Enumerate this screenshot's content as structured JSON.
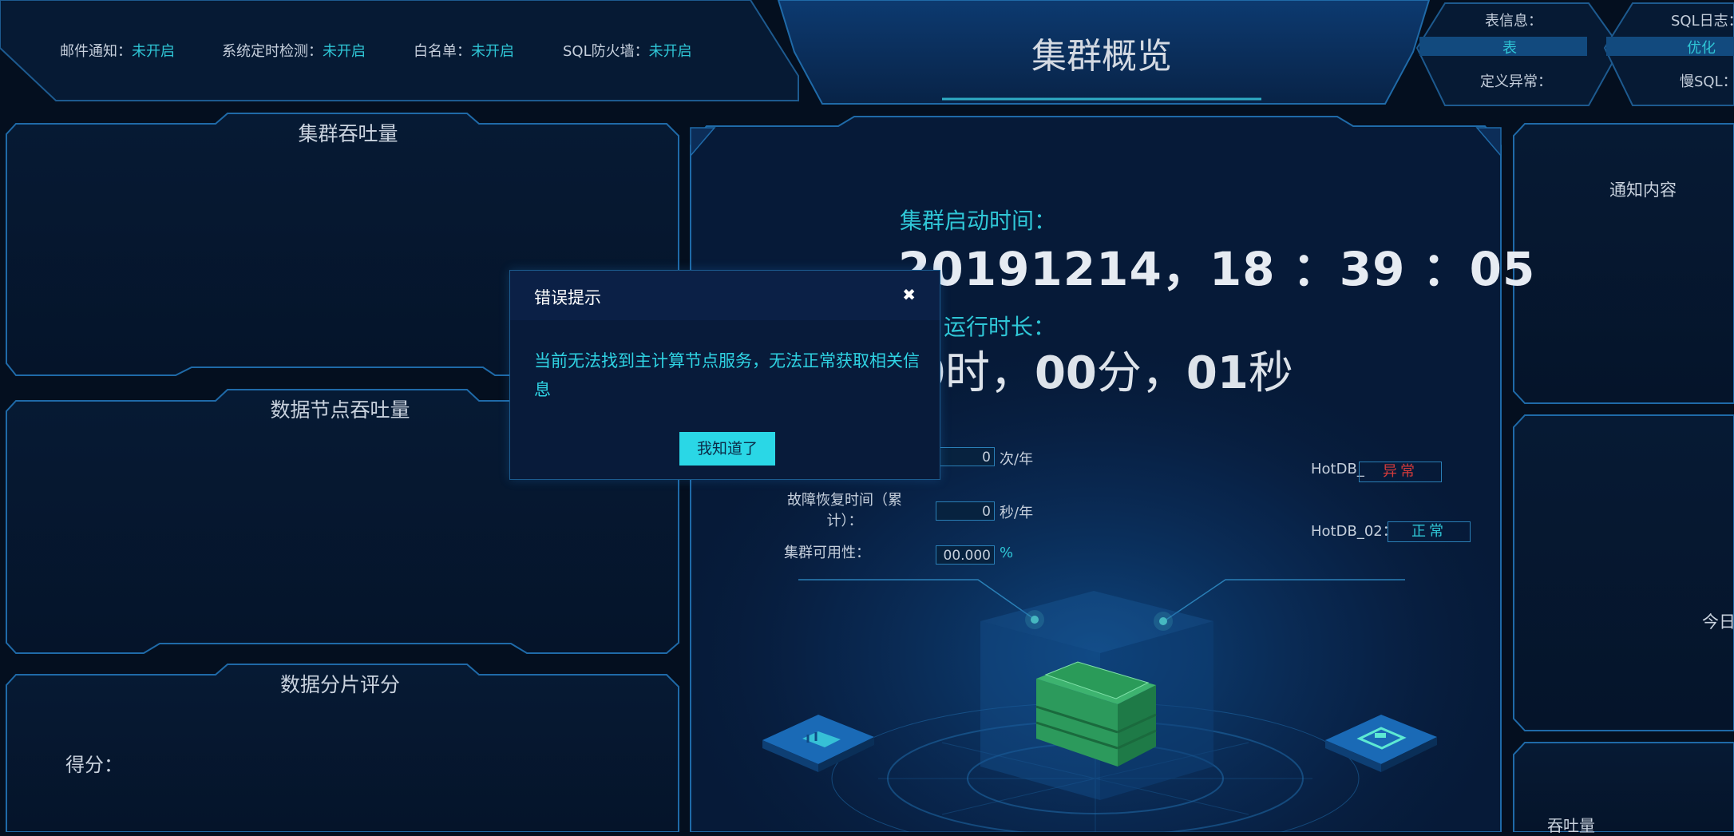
{
  "status_bar": {
    "items": [
      {
        "label": "邮件通知：",
        "value": "未开启"
      },
      {
        "label": "系统定时检测：",
        "value": "未开启"
      },
      {
        "label": "白名单：",
        "value": "未开启"
      },
      {
        "label": "SQL防火墙：",
        "value": "未开启"
      }
    ]
  },
  "header": {
    "title": "集群概览"
  },
  "top_right": {
    "table_info": {
      "label": "表信息：",
      "value": "表",
      "sub_label": "定义异常："
    },
    "sql_log": {
      "label": "SQL日志：",
      "value": "优化",
      "sub_label": "慢SQL："
    }
  },
  "left_panels": {
    "cluster_throughput": "集群吞吐量",
    "datanode_throughput": "数据节点吞吐量",
    "shard_score": {
      "title": "数据分片评分",
      "score_label": "得分："
    }
  },
  "center": {
    "start_time_label": "集群启动时间：",
    "start_time_value": "20191214，18 ：39 ：05",
    "runtime_label": "运行时长：",
    "runtime": {
      "hours": "0",
      "h_unit": "时，",
      "minutes": "00",
      "m_unit": "分，",
      "seconds": "01",
      "s_unit": "秒"
    },
    "stats": [
      {
        "label": "",
        "value": "0",
        "unit": "次/年"
      },
      {
        "label": "故障恢复时间（累计）：",
        "value": "0",
        "unit": "秒/年"
      },
      {
        "label": "集群可用性：",
        "value": "00.000",
        "unit": "%"
      }
    ],
    "nodes": [
      {
        "label": "HotDB_",
        "status": "异常",
        "color": "#d43b3b"
      },
      {
        "label": "HotDB_02：",
        "status": "正常",
        "color": "#2fc6d6"
      }
    ]
  },
  "right_panels": {
    "notice_title": "通知内容",
    "today_label": "今日",
    "throughput_label": "吞吐量"
  },
  "modal": {
    "title": "错误提示",
    "close_icon": "✖",
    "message": "当前无法找到主计算节点服务，无法正常获取相关信息",
    "confirm_button": "我知道了"
  }
}
